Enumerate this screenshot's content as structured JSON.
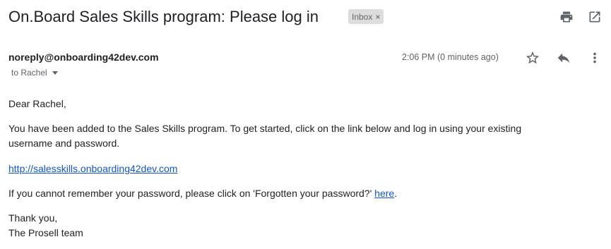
{
  "email": {
    "subject": "On.Board Sales Skills program: Please log in",
    "label": "Inbox",
    "label_close": "×",
    "sender": "noreply@onboarding42dev.com",
    "to": "to Rachel",
    "time": "2:06 PM (0 minutes ago)",
    "greeting": "Dear Rachel,",
    "para1_line1": "You have been added to the Sales Skills program. To get started, click on the link below and log in using your existing",
    "para1_line2": "username and password.",
    "link": "http://salesskills.onboarding42dev.com",
    "para2_prefix": "If you cannot remember your password, please click on 'Forgotten your password?' ",
    "para2_link": "here",
    "para2_suffix": ".",
    "signoff": "Thank you,",
    "team": "The Prosell team"
  },
  "icons": {
    "print": "print-icon",
    "open_new": "open-in-new-icon",
    "star": "star-icon",
    "reply": "reply-icon",
    "more": "more-vert-icon"
  }
}
